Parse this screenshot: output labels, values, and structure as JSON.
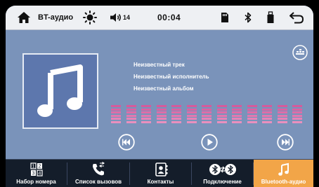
{
  "status_bar": {
    "source_label": "BT-аудио",
    "volume_level": "14",
    "time": "00:04"
  },
  "track": {
    "title": "Неизвестный трек",
    "artist": "Неизвестный исполнитель",
    "album": "Неизвестный альбом"
  },
  "equalizer": {
    "bands": 13,
    "levels": [
      6,
      6,
      6,
      6,
      6,
      6,
      6,
      6,
      6,
      6,
      6,
      6,
      6
    ],
    "max_level": 6
  },
  "colors": {
    "accent": "#f2a548",
    "nav_background": "#141d2a",
    "main_background": "#7a93ba"
  },
  "nav": {
    "items": [
      {
        "label": "Набор номера",
        "icon": "dialpad-icon"
      },
      {
        "label": "Список вызовов",
        "icon": "call-log-icon"
      },
      {
        "label": "Контакты",
        "icon": "contacts-icon"
      },
      {
        "label": "Подключение",
        "icon": "bluetooth-connect-icon"
      },
      {
        "label": "Bluetooth-аудио",
        "icon": "music-note-icon",
        "active": true
      }
    ]
  }
}
